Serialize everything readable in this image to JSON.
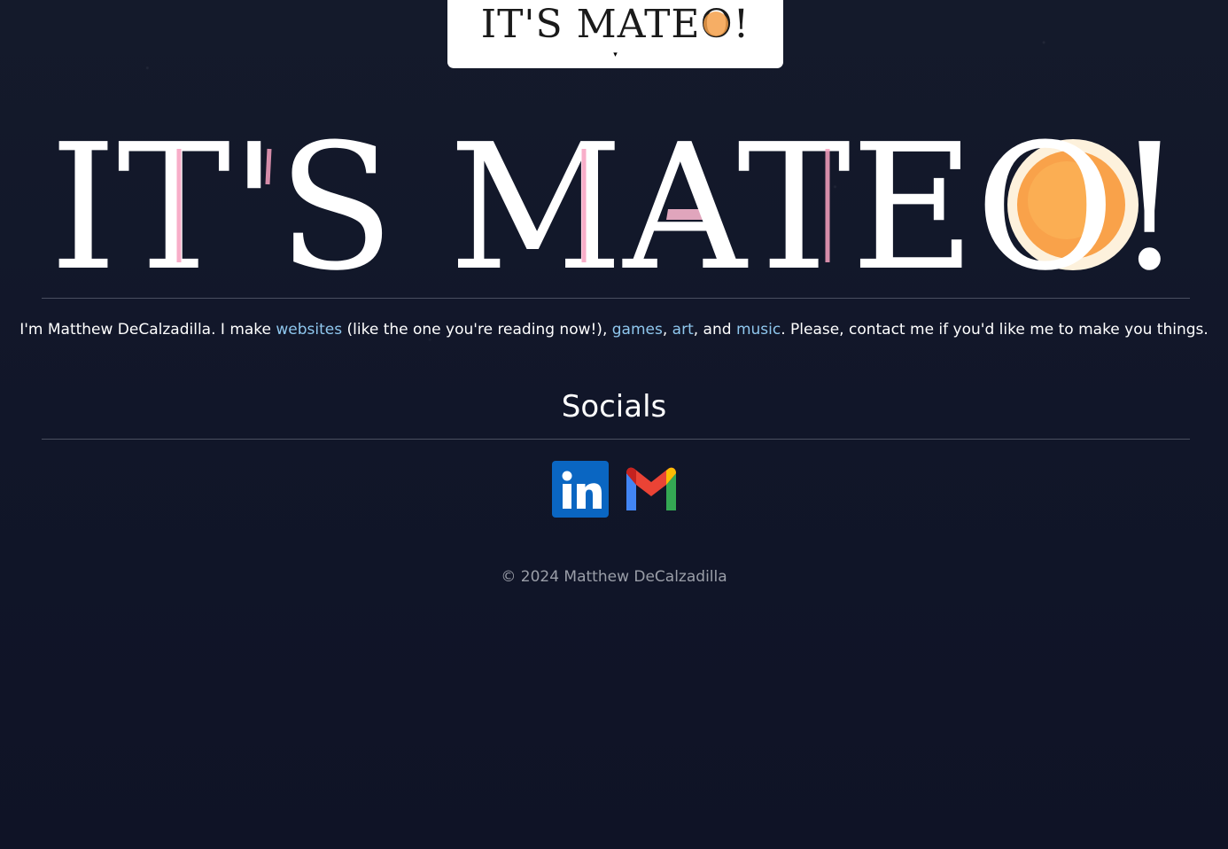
{
  "nav": {
    "logo_text": "IT'S MATEO!",
    "menu_arrow": "▾"
  },
  "hero": {
    "title": "IT'S MATEO!"
  },
  "intro": {
    "text_before": "I'm Matthew DeCalzadilla. I make ",
    "link_websites": "websites",
    "text_after_websites": " (like the one you're reading now!), ",
    "link_games": "games",
    "comma_1": ", ",
    "link_art": "art",
    "text_and": ", and ",
    "link_music": "music",
    "text_end": ". Please, contact me if you'd like me to make you things."
  },
  "socials": {
    "heading": "Socials",
    "linkedin": {
      "label": "in",
      "color": "#0a66c2"
    },
    "gmail": {
      "label": "Gmail"
    }
  },
  "footer": {
    "copyright": "© 2024 Matthew DeCalzadilla"
  }
}
